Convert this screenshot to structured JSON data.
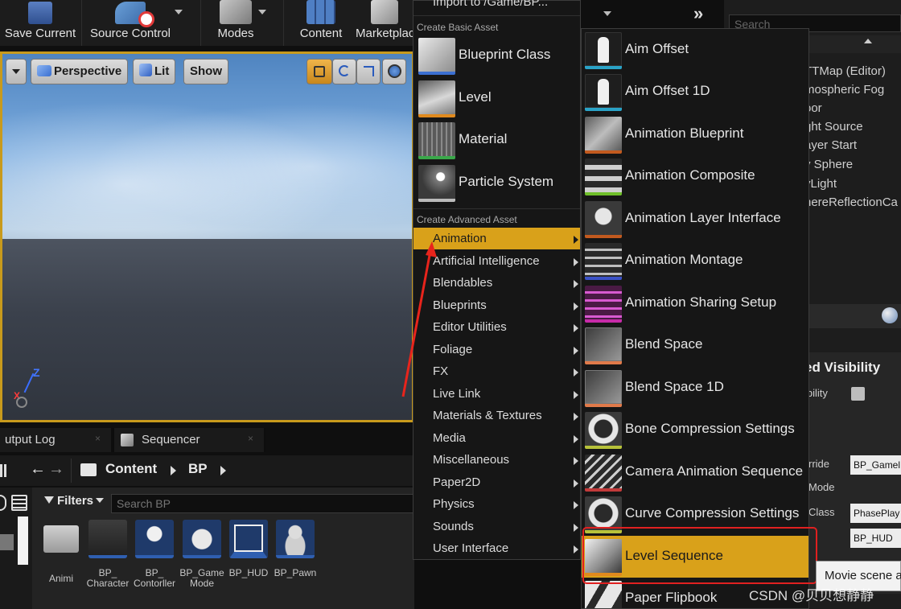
{
  "toolbar": {
    "buttons": [
      {
        "label": "Save Current",
        "icon": "floppy-disk-icon"
      },
      {
        "label": "Source Control",
        "icon": "source-control-icon"
      },
      {
        "label": "Modes",
        "icon": "modes-icon"
      },
      {
        "label": "Content",
        "icon": "content-icon"
      },
      {
        "label": "Marketplace",
        "icon": "marketplace-icon"
      }
    ]
  },
  "viewport": {
    "perspective_label": "Perspective",
    "lit_label": "Lit",
    "show_label": "Show",
    "axis_z": "Z",
    "axis_x": "X"
  },
  "tabs": [
    {
      "label": "utput Log"
    },
    {
      "label": "Sequencer"
    }
  ],
  "content_browser": {
    "breadcrumb": [
      "Content",
      "BP"
    ],
    "filters_label": "Filters",
    "search_placeholder": "Search BP",
    "assets": [
      {
        "name": "Animi"
      },
      {
        "name": "BP_ Character"
      },
      {
        "name": "BP_ Contorller"
      },
      {
        "name": "BP_Game Mode"
      },
      {
        "name": "BP_HUD"
      },
      {
        "name": "BP_Pawn"
      }
    ]
  },
  "menu": {
    "top_path": "Import to /Game/BP...",
    "basic_header": "Create Basic Asset",
    "basic_items": [
      {
        "label": "Blueprint Class",
        "accent": "#3b6fd1"
      },
      {
        "label": "Level",
        "accent": "#e08a1e"
      },
      {
        "label": "Material",
        "accent": "#3aa84a"
      },
      {
        "label": "Particle System",
        "accent": "#bbbbbb"
      }
    ],
    "advanced_header": "Create Advanced Asset",
    "advanced_items": [
      {
        "label": "Animation",
        "active": true
      },
      {
        "label": "Artificial Intelligence"
      },
      {
        "label": "Blendables"
      },
      {
        "label": "Blueprints"
      },
      {
        "label": "Editor Utilities"
      },
      {
        "label": "Foliage"
      },
      {
        "label": "FX"
      },
      {
        "label": "Live Link"
      },
      {
        "label": "Materials & Textures"
      },
      {
        "label": "Media"
      },
      {
        "label": "Miscellaneous"
      },
      {
        "label": "Paper2D"
      },
      {
        "label": "Physics"
      },
      {
        "label": "Sounds"
      },
      {
        "label": "User Interface"
      }
    ]
  },
  "submenu": {
    "items": [
      {
        "label": "Aim Offset",
        "accent": "#2aa3c7"
      },
      {
        "label": "Aim Offset 1D",
        "accent": "#2aa3c7"
      },
      {
        "label": "Animation Blueprint",
        "accent": "#c25a1f"
      },
      {
        "label": "Animation Composite",
        "accent": "#6fbf2a"
      },
      {
        "label": "Animation Layer Interface",
        "accent": "#c25a1f"
      },
      {
        "label": "Animation Montage",
        "accent": "#3b52c7"
      },
      {
        "label": "Animation Sharing Setup",
        "accent": "#c72aa8"
      },
      {
        "label": "Blend Space",
        "accent": "#e07a4a"
      },
      {
        "label": "Blend Space 1D",
        "accent": "#e07a4a"
      },
      {
        "label": "Bone Compression Settings",
        "accent": "#b7c23a"
      },
      {
        "label": "Camera Animation Sequence",
        "accent": "#c23a3a"
      },
      {
        "label": "Curve Compression Settings",
        "accent": "#b7c23a"
      },
      {
        "label": "Level Sequence",
        "accent": "#e08a1e",
        "active": true
      },
      {
        "label": "Paper Flipbook",
        "accent": "#c25a1f"
      }
    ]
  },
  "right_panel": {
    "search_placeholder": "Search",
    "outliner_items": [
      "TTMap (Editor)",
      "mospheric Fog",
      "oor",
      "ght Source",
      "ayer Start",
      "y Sphere",
      "yLight",
      "hereReflectionCa"
    ],
    "section_title": "ed Visibility",
    "visibility_label": "ibility",
    "rows": [
      {
        "label": "rride",
        "value": "BP_Gamel"
      },
      {
        "label": "Mode",
        "value": ""
      },
      {
        "label": "Class",
        "value": "PhasePlay"
      },
      {
        "label": "",
        "value": "BP_HUD"
      }
    ]
  },
  "tooltip": "Movie scene a",
  "watermark": "CSDN @贝贝想静静"
}
